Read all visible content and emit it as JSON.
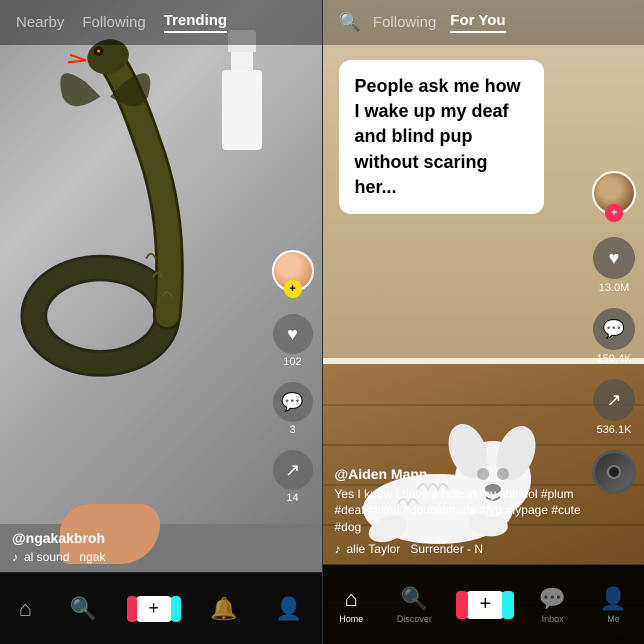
{
  "left": {
    "nav": {
      "nearby": "Nearby",
      "following": "Following",
      "trending": "Trending",
      "active": "trending"
    },
    "actions": {
      "likes": "102",
      "comments": "3",
      "shares": "14"
    },
    "user": {
      "handle": "@ngakakbroh",
      "music": "al sound",
      "music_suffix": "ngak"
    },
    "bottomNav": {
      "home": "Home",
      "search": "Discover",
      "add": "+",
      "notifications": "",
      "profile": ""
    }
  },
  "right": {
    "header": {
      "following": "Following",
      "for_you": "For You"
    },
    "caption": "People ask me how I wake up my deaf and blind pup without scaring her...",
    "actions": {
      "likes": "13.0M",
      "comments": "159.4K",
      "shares": "536.1K"
    },
    "user": {
      "handle": "@Aiden Mann",
      "desc": "Yes I know I have a hole in my shirt lol #plum #deaf #blind #doublemerle #fyp #fypage #cute #dog",
      "music_icon": "♪",
      "music": "alie Taylor",
      "music_song": "Surrender - N"
    },
    "bottomNav": {
      "home": "Home",
      "discover": "Discover",
      "add": "+",
      "inbox": "Inbox",
      "me": "Me"
    }
  }
}
